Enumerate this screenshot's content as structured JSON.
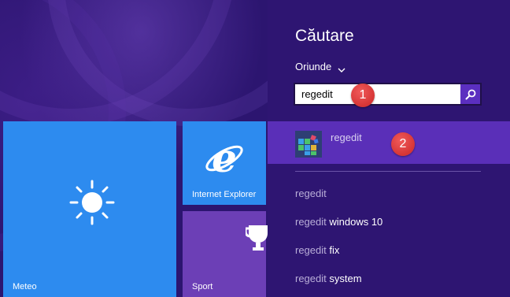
{
  "start": {
    "tiles": [
      {
        "label": "Meteo",
        "icon": "sun-icon",
        "color": "#2d8bef"
      },
      {
        "label": "Internet Explorer",
        "icon": "internet-explorer-icon",
        "color": "#2d8bef"
      },
      {
        "label": "Sport",
        "icon": "trophy-icon",
        "color": "#6c3fb6"
      }
    ]
  },
  "search": {
    "title": "Căutare",
    "scope": "Oriunde",
    "query": "regedit",
    "top_result": {
      "label": "regedit",
      "icon": "registry-editor-icon"
    },
    "suggestions": [
      {
        "prefix": "regedit",
        "suffix": ""
      },
      {
        "prefix": "regedit",
        "suffix": " windows 10"
      },
      {
        "prefix": "regedit",
        "suffix": " fix"
      },
      {
        "prefix": "regedit",
        "suffix": " system"
      }
    ]
  },
  "callouts": [
    "1",
    "2"
  ],
  "colors": {
    "pane_bg": "#2e1572",
    "selected_bg": "#5a2fb8",
    "tile_blue": "#2d8bef",
    "tile_purple": "#6c3fb6",
    "callout_red": "#d63535"
  }
}
